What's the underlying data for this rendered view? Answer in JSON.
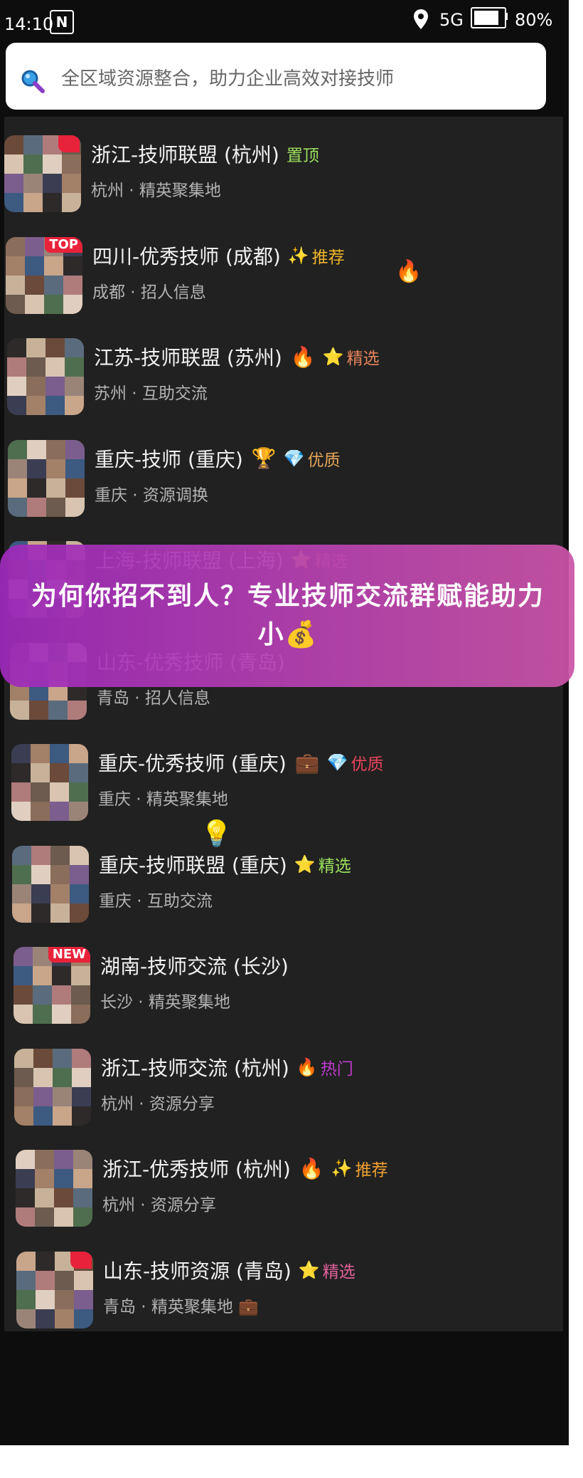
{
  "status_bar": {
    "time": "14:10",
    "nfc": "N",
    "network": "5G",
    "battery": "80%",
    "battery_level": 0.8
  },
  "search": {
    "placeholder": "全区域资源整合，助力企业高效对接技师",
    "icon": "search-icon"
  },
  "items": [
    {
      "title": "浙江-技师联盟 (杭州)",
      "tag": "置顶",
      "tag_emoji": "",
      "tag_color": "#9be15d",
      "extra_emoji": "",
      "subtitle": "杭州 · 精英聚集地",
      "badge": "check"
    },
    {
      "title": "四川-优秀技师 (成都)",
      "tag": "推荐",
      "tag_emoji": "✨",
      "tag_color": "#f0b429",
      "extra_emoji": "",
      "subtitle": "成都 · 招人信息",
      "badge": "TOP"
    },
    {
      "title": "江苏-技师联盟 (苏州)",
      "tag": "精选",
      "tag_emoji": "⭐",
      "tag_color": "#e8845a",
      "extra_emoji": "🔥",
      "subtitle": "苏州 · 互助交流",
      "badge": ""
    },
    {
      "title": "重庆-技师 (重庆)",
      "tag": "优质",
      "tag_emoji": "💎",
      "tag_color": "#e8a55a",
      "extra_emoji": "🏆",
      "subtitle": "重庆 · 资源调换",
      "badge": ""
    },
    {
      "title": "上海-技师联盟 (上海)",
      "tag": "精选",
      "tag_emoji": "⭐",
      "tag_color": "#e8845a",
      "extra_emoji": "",
      "subtitle": "",
      "badge": ""
    },
    {
      "title": "山东-优秀技师 (青岛)",
      "tag": "",
      "tag_emoji": "",
      "tag_color": "#e8845a",
      "extra_emoji": "",
      "subtitle": "青岛 · 招人信息",
      "badge": ""
    },
    {
      "title": "重庆-优秀技师 (重庆)",
      "tag": "优质",
      "tag_emoji": "💎",
      "tag_color": "#e8445a",
      "extra_emoji": "💼",
      "subtitle": "重庆 · 精英聚集地",
      "badge": ""
    },
    {
      "title": "重庆-技师联盟 (重庆)",
      "tag": "精选",
      "tag_emoji": "⭐",
      "tag_color": "#9be15d",
      "extra_emoji": "",
      "subtitle": "重庆 · 互助交流",
      "badge": ""
    },
    {
      "title": "湖南-技师交流 (长沙)",
      "tag": "",
      "tag_emoji": "",
      "tag_color": "#ffffff",
      "extra_emoji": "",
      "subtitle": "长沙 · 精英聚集地",
      "badge": "NEW"
    },
    {
      "title": "浙江-技师交流 (杭州)",
      "tag": "热门",
      "tag_emoji": "🔥",
      "tag_color": "#c03ad0",
      "extra_emoji": "",
      "subtitle": "杭州 · 资源分享",
      "badge": ""
    },
    {
      "title": "浙江-优秀技师 (杭州)",
      "tag": "推荐",
      "tag_emoji": "✨",
      "tag_color": "#f0a030",
      "extra_emoji": "🔥",
      "subtitle": "杭州 · 资源分享",
      "badge": ""
    },
    {
      "title": "山东-技师资源 (青岛)",
      "tag": "精选",
      "tag_emoji": "⭐",
      "tag_color": "#e0609a",
      "extra_emoji": "",
      "subtitle": "青岛 · 精英聚集地 💼",
      "badge": "corner"
    }
  ],
  "floating": {
    "fire": "🔥",
    "bulb": "💡"
  },
  "banner": {
    "text": "为何你招不到人？专业技师交流群赋能助力 小💰"
  }
}
